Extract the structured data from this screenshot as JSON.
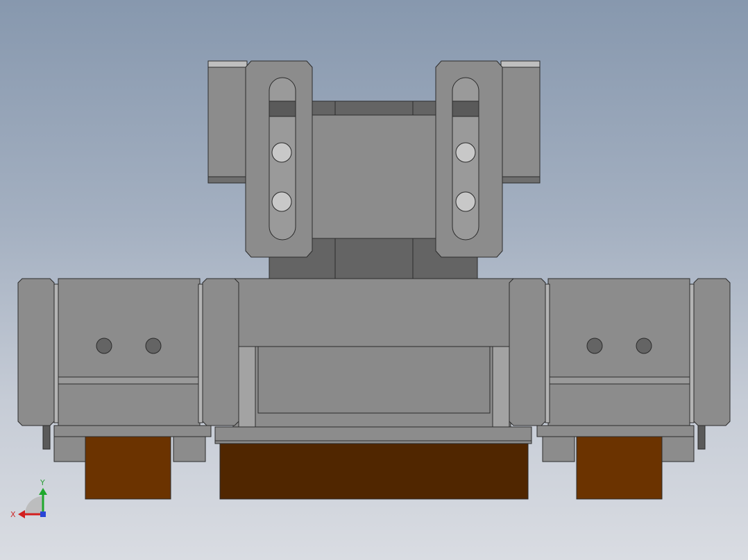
{
  "axes": {
    "y_label": "Y",
    "x_label": "X",
    "colors": {
      "y": "#1fa82c",
      "x": "#d21f1f",
      "z": "#2a46d6",
      "label_y": "#2e9e3a",
      "label_x": "#cc2b2b"
    }
  },
  "colors": {
    "body": "#8c8c8c",
    "body_light": "#9a9a9a",
    "body_dark": "#646464",
    "edge": "#2b2b2b",
    "pad": "#6b3300",
    "pad_dark": "#502600"
  }
}
